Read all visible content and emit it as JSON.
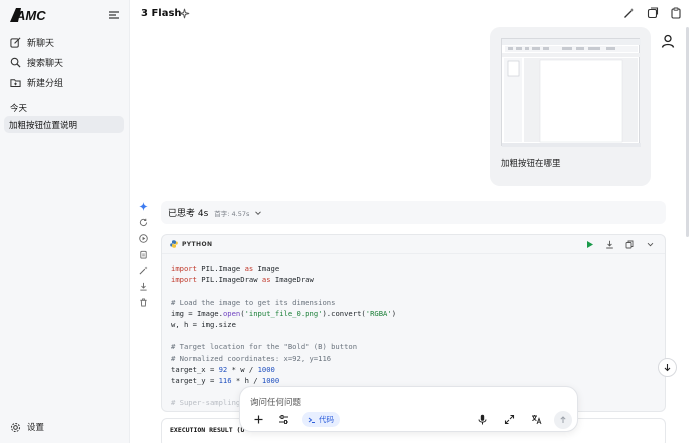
{
  "sidebar": {
    "logo_text": "AMC",
    "items": [
      {
        "label": "新聊天",
        "icon": "edit-icon"
      },
      {
        "label": "搜索聊天",
        "icon": "search-icon"
      },
      {
        "label": "新建分组",
        "icon": "folder-plus-icon"
      }
    ],
    "section_today": "今天",
    "active_chat": "加粗按钮位置说明",
    "settings_label": "设置"
  },
  "header": {
    "model_name": "3 Flash"
  },
  "user_message": {
    "text": "加粗按钮在哪里"
  },
  "thinking": {
    "label": "已思考 4s",
    "sub": "首字: 4.57s"
  },
  "code_block": {
    "language": "PYTHON",
    "lines": [
      "import PIL.Image as Image",
      "import PIL.ImageDraw as ImageDraw",
      "",
      "# Load the image to get its dimensions",
      "img = Image.open('input_file_0.png').convert('RGBA')",
      "w, h = img.size",
      "",
      "# Target location for the \"Bold\" (B) button",
      "# Normalized coordinates: x=92, y=116",
      "target_x = 92 * w / 1000",
      "target_y = 116 * h / 1000",
      "",
      "# Super-sampling"
    ]
  },
  "result": {
    "label": "EXECUTION RESULT (U"
  },
  "composer": {
    "placeholder": "询问任何问题",
    "code_chip": "代码"
  },
  "colors": {
    "accent": "#2f5fdb",
    "run": "#1a9a4a",
    "sidebar_bg": "#f6f7f9"
  }
}
